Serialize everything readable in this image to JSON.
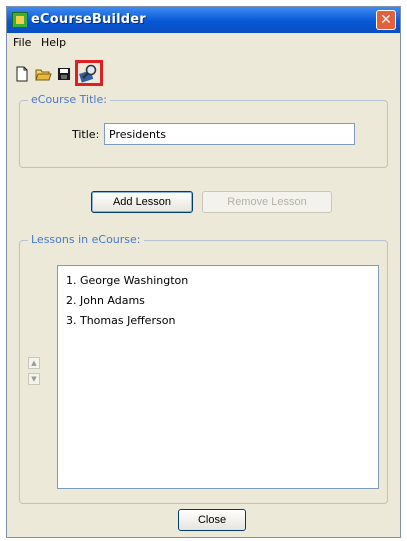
{
  "window": {
    "title": "eCourseBuilder",
    "close_glyph": "✕"
  },
  "menu": {
    "items": [
      "File",
      "Help"
    ]
  },
  "toolbar": {
    "icons": [
      "new-document-icon",
      "open-folder-icon",
      "save-icon",
      "preview-magnifier-icon"
    ]
  },
  "title_group": {
    "legend": "eCourse Title:",
    "field_label": "Title:",
    "field_value": "Presidents"
  },
  "actions": {
    "add_label": "Add Lesson",
    "remove_label": "Remove Lesson"
  },
  "lessons_group": {
    "legend": "Lessons in eCourse:",
    "items": [
      "1. George Washington",
      "2. John Adams",
      "3. Thomas Jefferson"
    ],
    "move_up_glyph": "▲",
    "move_down_glyph": "▼"
  },
  "footer": {
    "close_label": "Close"
  },
  "colors": {
    "title_bar": "#0857d7",
    "highlight": "#e02020",
    "group_title": "#4a78c8"
  }
}
